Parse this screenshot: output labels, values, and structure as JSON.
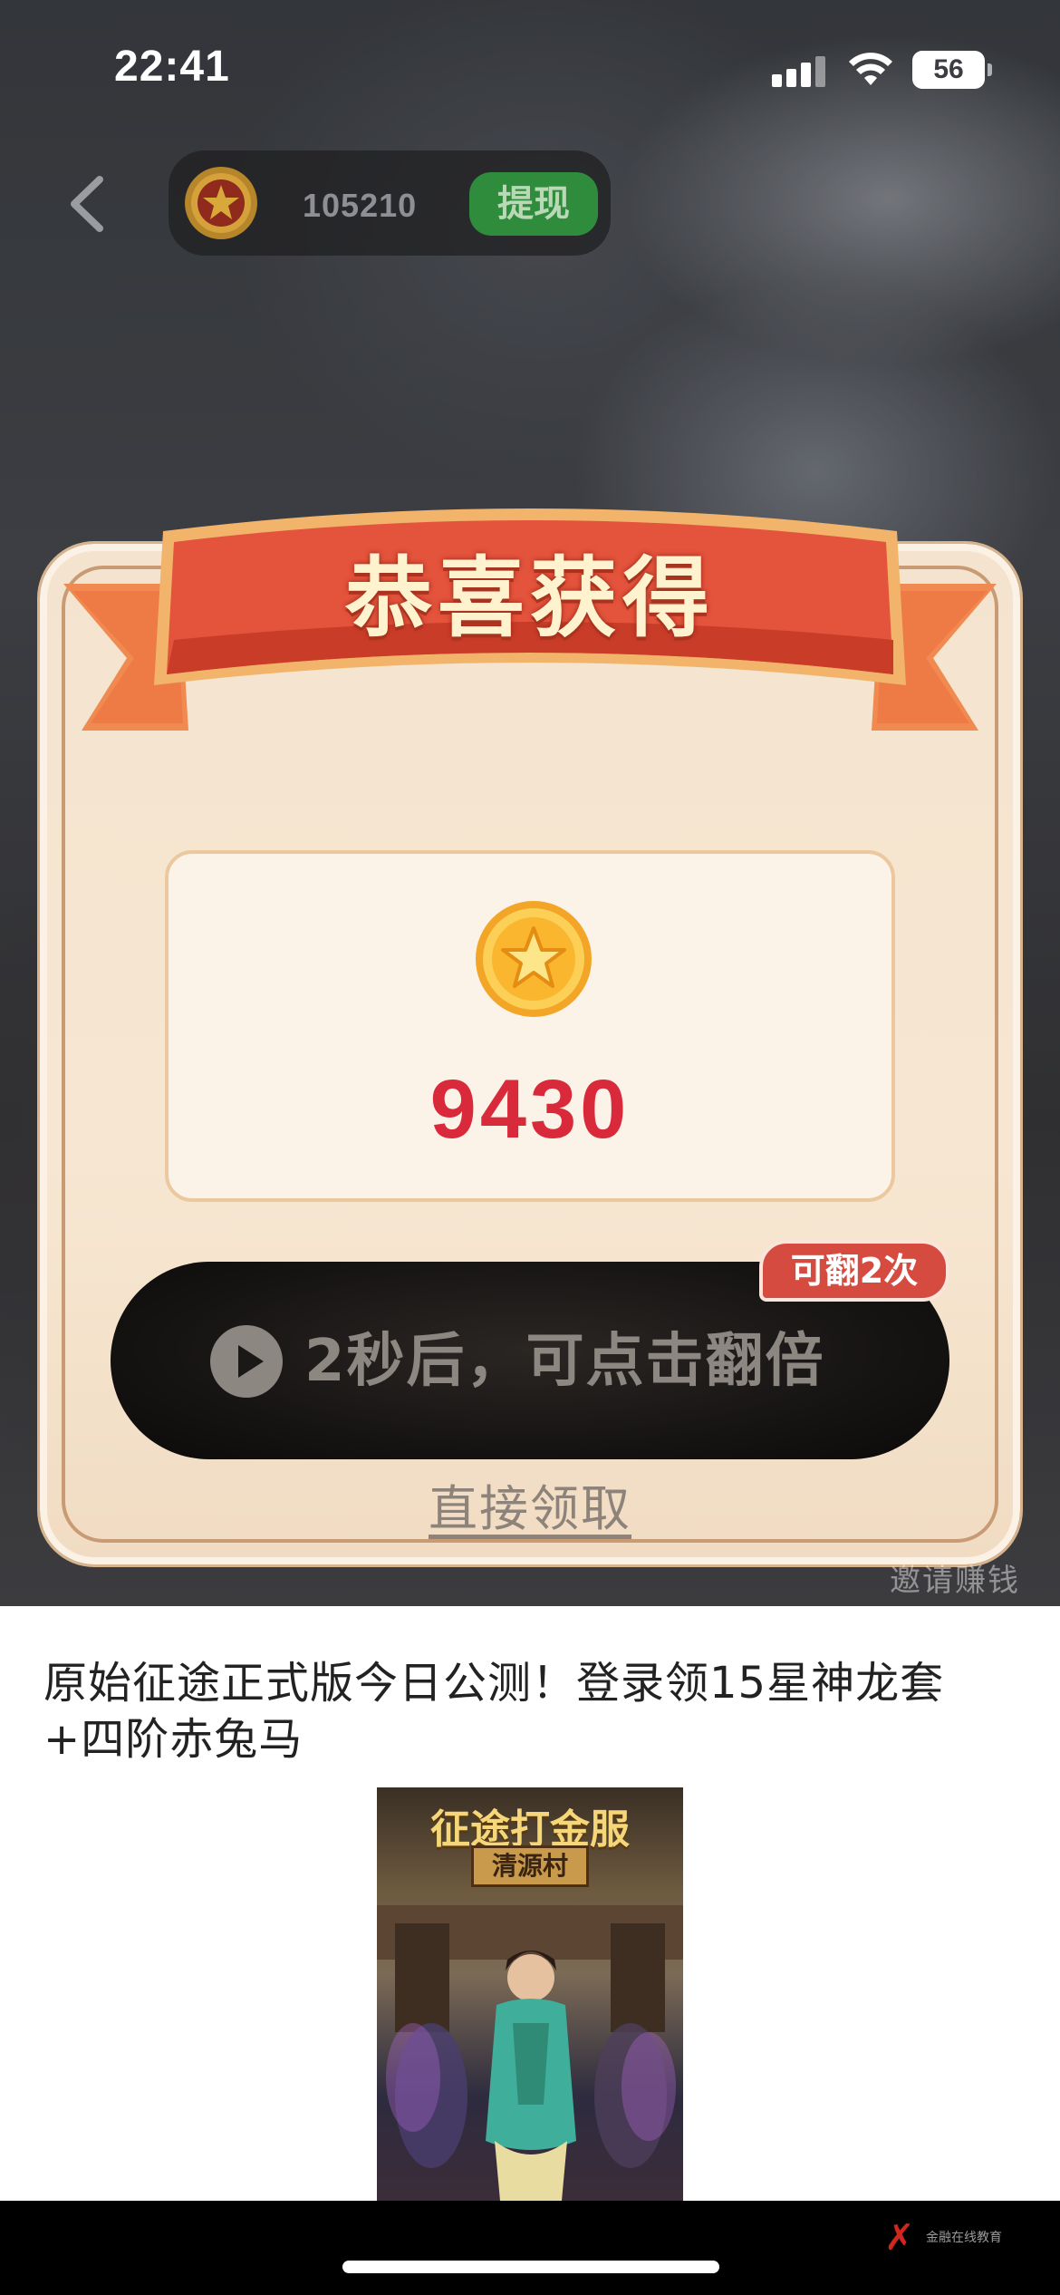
{
  "status_bar": {
    "time": "22:41",
    "battery": "56"
  },
  "header": {
    "coin_balance": "105210",
    "withdraw_label": "提现"
  },
  "dialog": {
    "title": "恭喜获得",
    "reward_amount": "9430",
    "double_button_label": "2秒后，可点击翻倍",
    "flip_badge": "可翻2次",
    "claim_directly_label": "直接领取"
  },
  "background": {
    "invite_hint": "邀请赚钱"
  },
  "ad": {
    "title": "原始征途正式版今日公测！登录领15星神龙套+四阶赤兔马",
    "image_logo_text": "征途打金服",
    "image_sign_text": "清源村"
  },
  "footer": {
    "watermark_text": "金融在线教育"
  },
  "colors": {
    "reward_red": "#d92a3c",
    "withdraw_green": "#2f8c3c",
    "ribbon_red": "#e4533c",
    "badge_red": "#d64b3f"
  },
  "icons": [
    "back-arrow-icon",
    "coin-icon",
    "play-icon",
    "signal-icon",
    "wifi-icon",
    "battery-icon"
  ]
}
